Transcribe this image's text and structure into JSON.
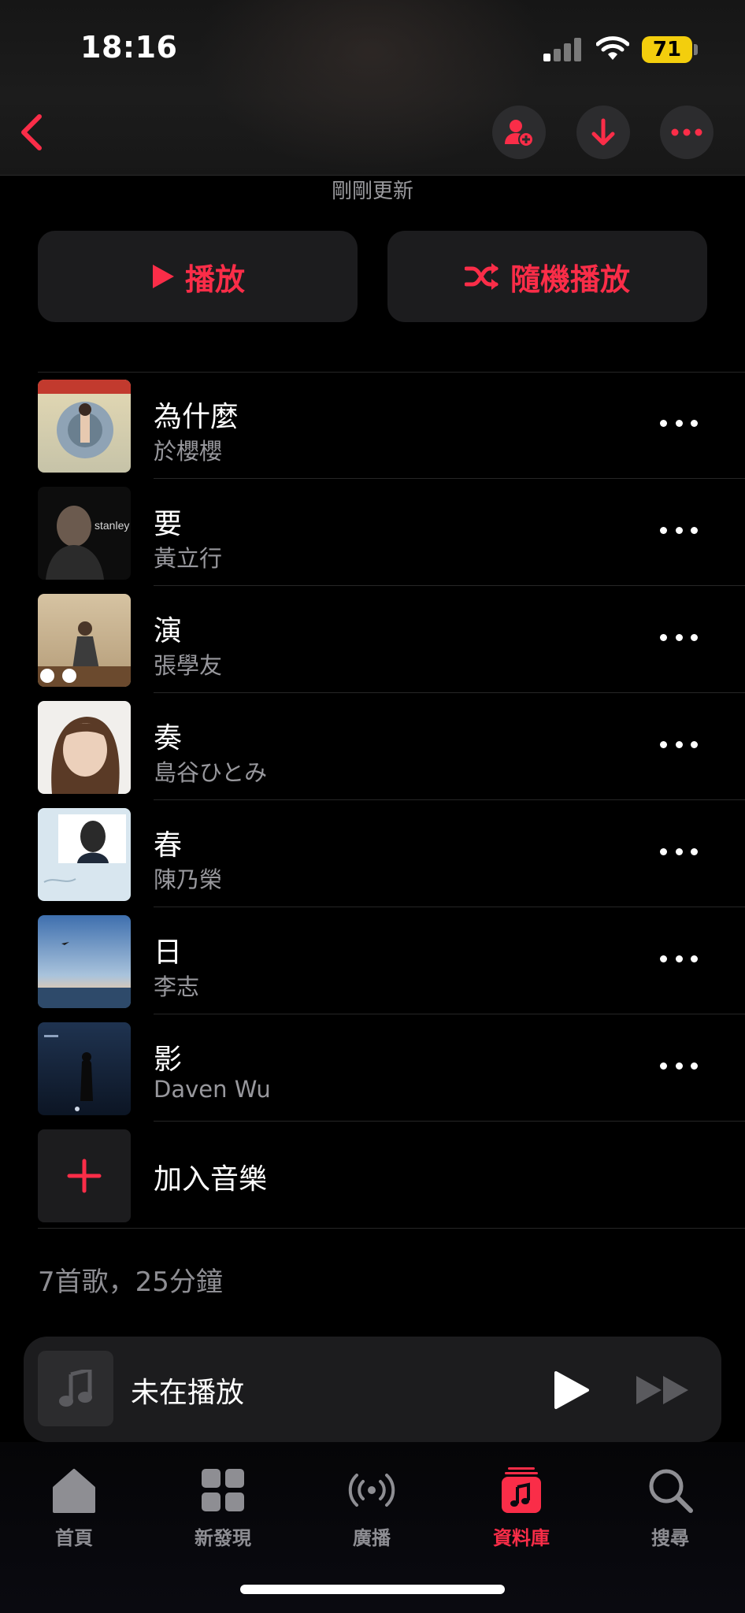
{
  "status_bar": {
    "time": "18:16",
    "battery": "71"
  },
  "header": {
    "subtitle": "剛剛更新",
    "actions": [
      "add-person",
      "download",
      "more"
    ]
  },
  "actions": {
    "play_label": "播放",
    "shuffle_label": "隨機播放"
  },
  "colors": {
    "accent": "#fa2d48",
    "background": "#000000",
    "secondary_text": "#98989d"
  },
  "songs": [
    {
      "title": "為什麼",
      "artist": "於櫻櫻"
    },
    {
      "title": "要",
      "artist": "黃立行"
    },
    {
      "title": "演",
      "artist": "張學友"
    },
    {
      "title": "奏",
      "artist": "島谷ひとみ"
    },
    {
      "title": "春",
      "artist": "陳乃榮"
    },
    {
      "title": "日",
      "artist": "李志"
    },
    {
      "title": "影",
      "artist": "Daven Wu"
    }
  ],
  "add_music_label": "加入音樂",
  "summary": "7首歌，25分鐘",
  "mini_player": {
    "title": "未在播放"
  },
  "tabs": [
    {
      "label": "首頁",
      "icon": "home-icon"
    },
    {
      "label": "新發現",
      "icon": "grid-icon"
    },
    {
      "label": "廣播",
      "icon": "radio-icon"
    },
    {
      "label": "資料庫",
      "icon": "library-icon",
      "active": true
    },
    {
      "label": "搜尋",
      "icon": "search-icon"
    }
  ]
}
